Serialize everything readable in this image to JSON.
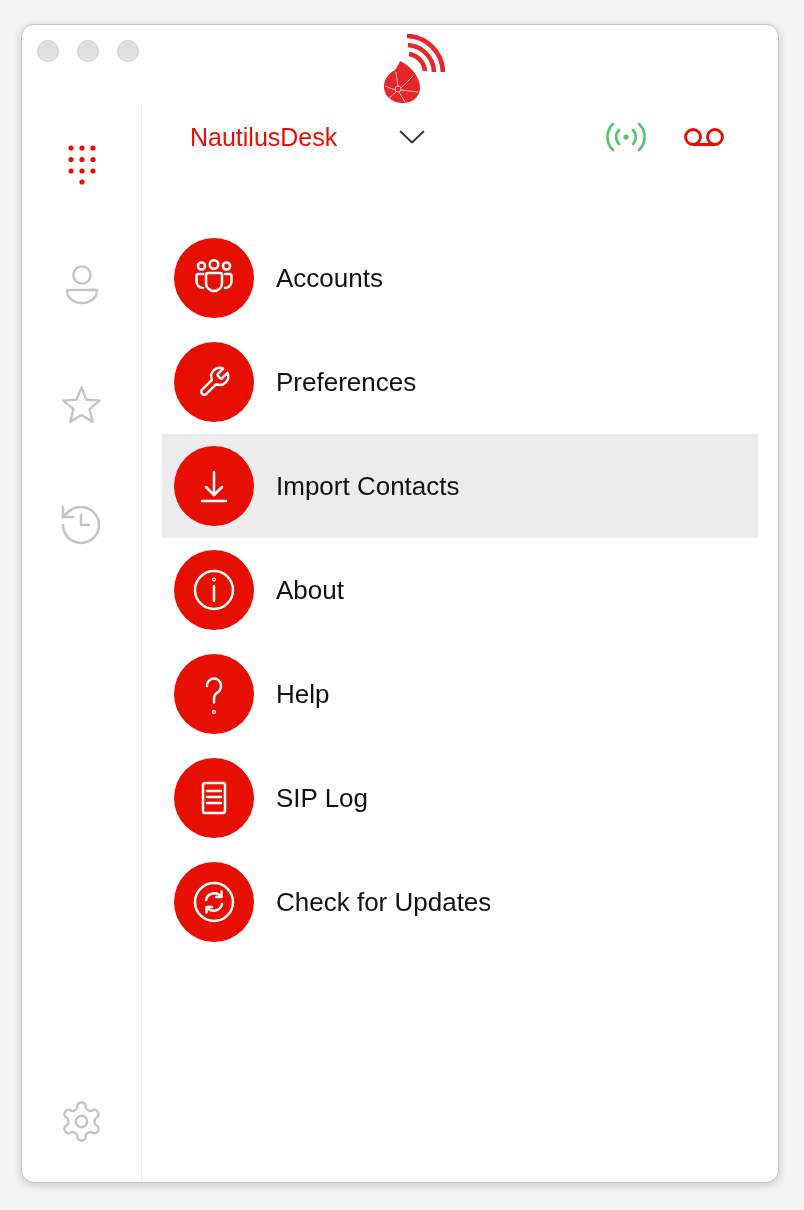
{
  "sidebar": {
    "items": [
      {
        "kind": "dialpad",
        "selected": true
      },
      {
        "kind": "contacts",
        "selected": false
      },
      {
        "kind": "favorites",
        "selected": false
      },
      {
        "kind": "history",
        "selected": false
      },
      {
        "kind": "settings",
        "selected": false
      }
    ]
  },
  "header": {
    "account": "NautilusDesk",
    "connected": true
  },
  "menu": {
    "items": [
      {
        "kind": "accounts",
        "label": "Accounts",
        "selected": false
      },
      {
        "kind": "preferences",
        "label": "Preferences",
        "selected": false
      },
      {
        "kind": "import",
        "label": "Import Contacts",
        "selected": true
      },
      {
        "kind": "about",
        "label": "About",
        "selected": false
      },
      {
        "kind": "help",
        "label": "Help",
        "selected": false
      },
      {
        "kind": "log",
        "label": "SIP Log",
        "selected": false
      },
      {
        "kind": "updates",
        "label": "Check for Updates",
        "selected": false
      }
    ]
  }
}
